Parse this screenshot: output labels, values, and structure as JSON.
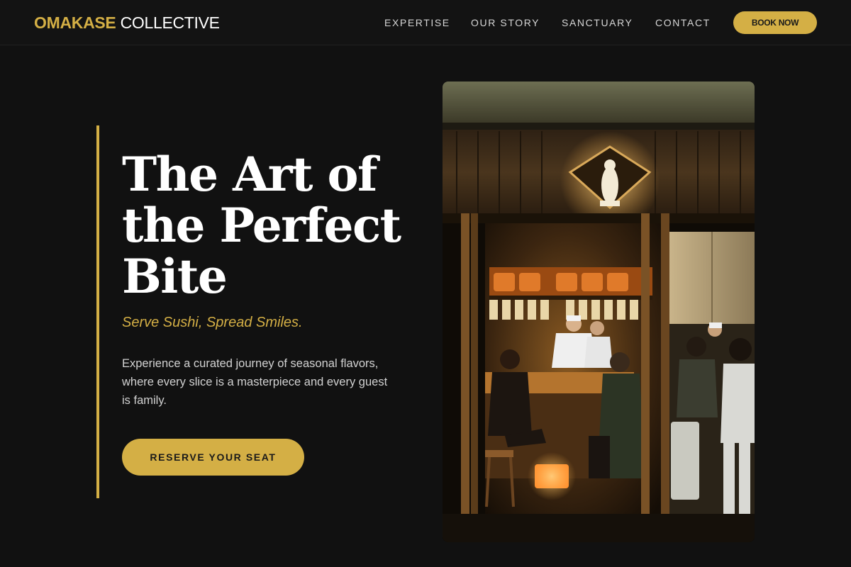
{
  "nav": {
    "brand_primary": "OMAKASE",
    "brand_secondary": "COLLECTIVE",
    "links": [
      {
        "label": "EXPERTISE"
      },
      {
        "label": "OUR STORY"
      },
      {
        "label": "SANCTUARY"
      },
      {
        "label": "CONTACT"
      }
    ],
    "book_label": "BOOK NOW"
  },
  "hero": {
    "headline": "The Art of the Perfect Bite",
    "tagline": "Serve Sushi, Spread Smiles.",
    "description": "Experience a curated journey of seasonal flavors, where every slice is a masterpiece and every guest is family.",
    "cta_label": "RESERVE YOUR SEAT"
  },
  "colors": {
    "accent": "#d4af45",
    "background": "#111111",
    "nav_background": "#131313"
  }
}
